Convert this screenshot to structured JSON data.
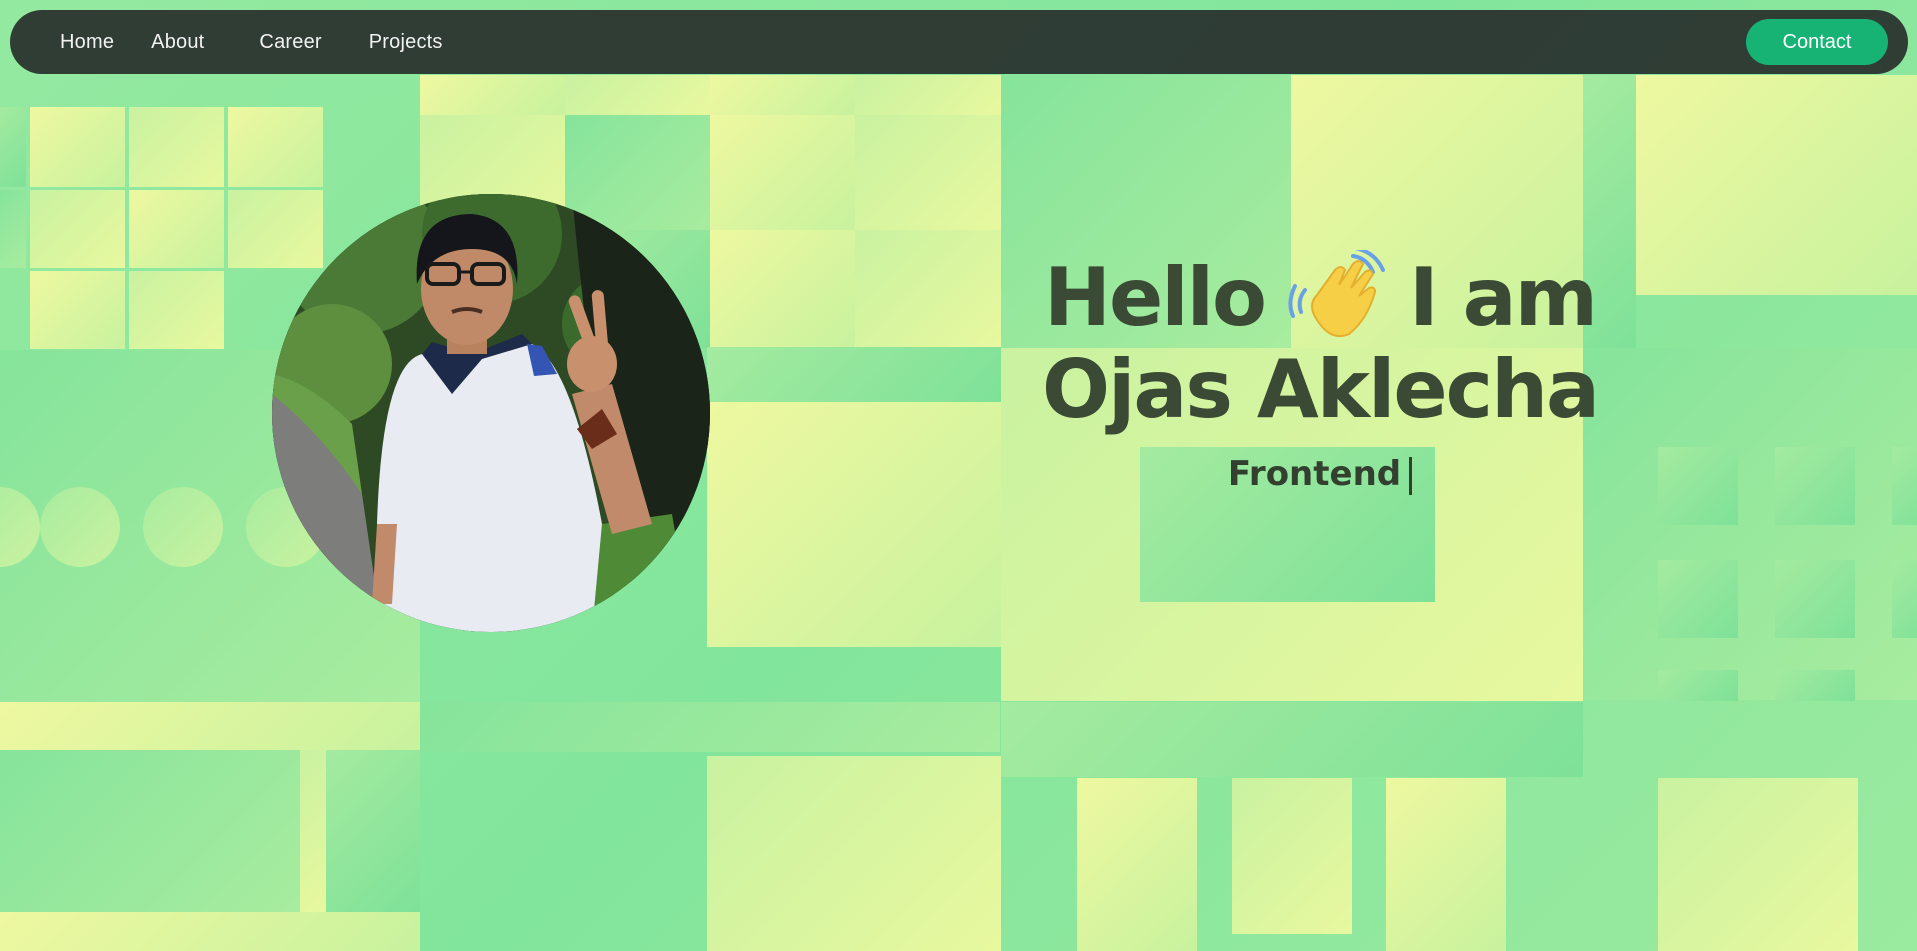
{
  "nav": {
    "links": [
      "Home",
      "About",
      "Career",
      "Projects"
    ],
    "contact_label": "Contact"
  },
  "hero": {
    "greeting": "Hello",
    "greeting_suffix": "I am",
    "name": "Ojas Aklecha",
    "role": "Frontend"
  },
  "icons": {
    "wave": "waving-hand-icon",
    "profile": "profile-photo"
  },
  "colors": {
    "accent": "#16b374",
    "navbar": "#2b312f",
    "heading": "#3a4a34"
  }
}
